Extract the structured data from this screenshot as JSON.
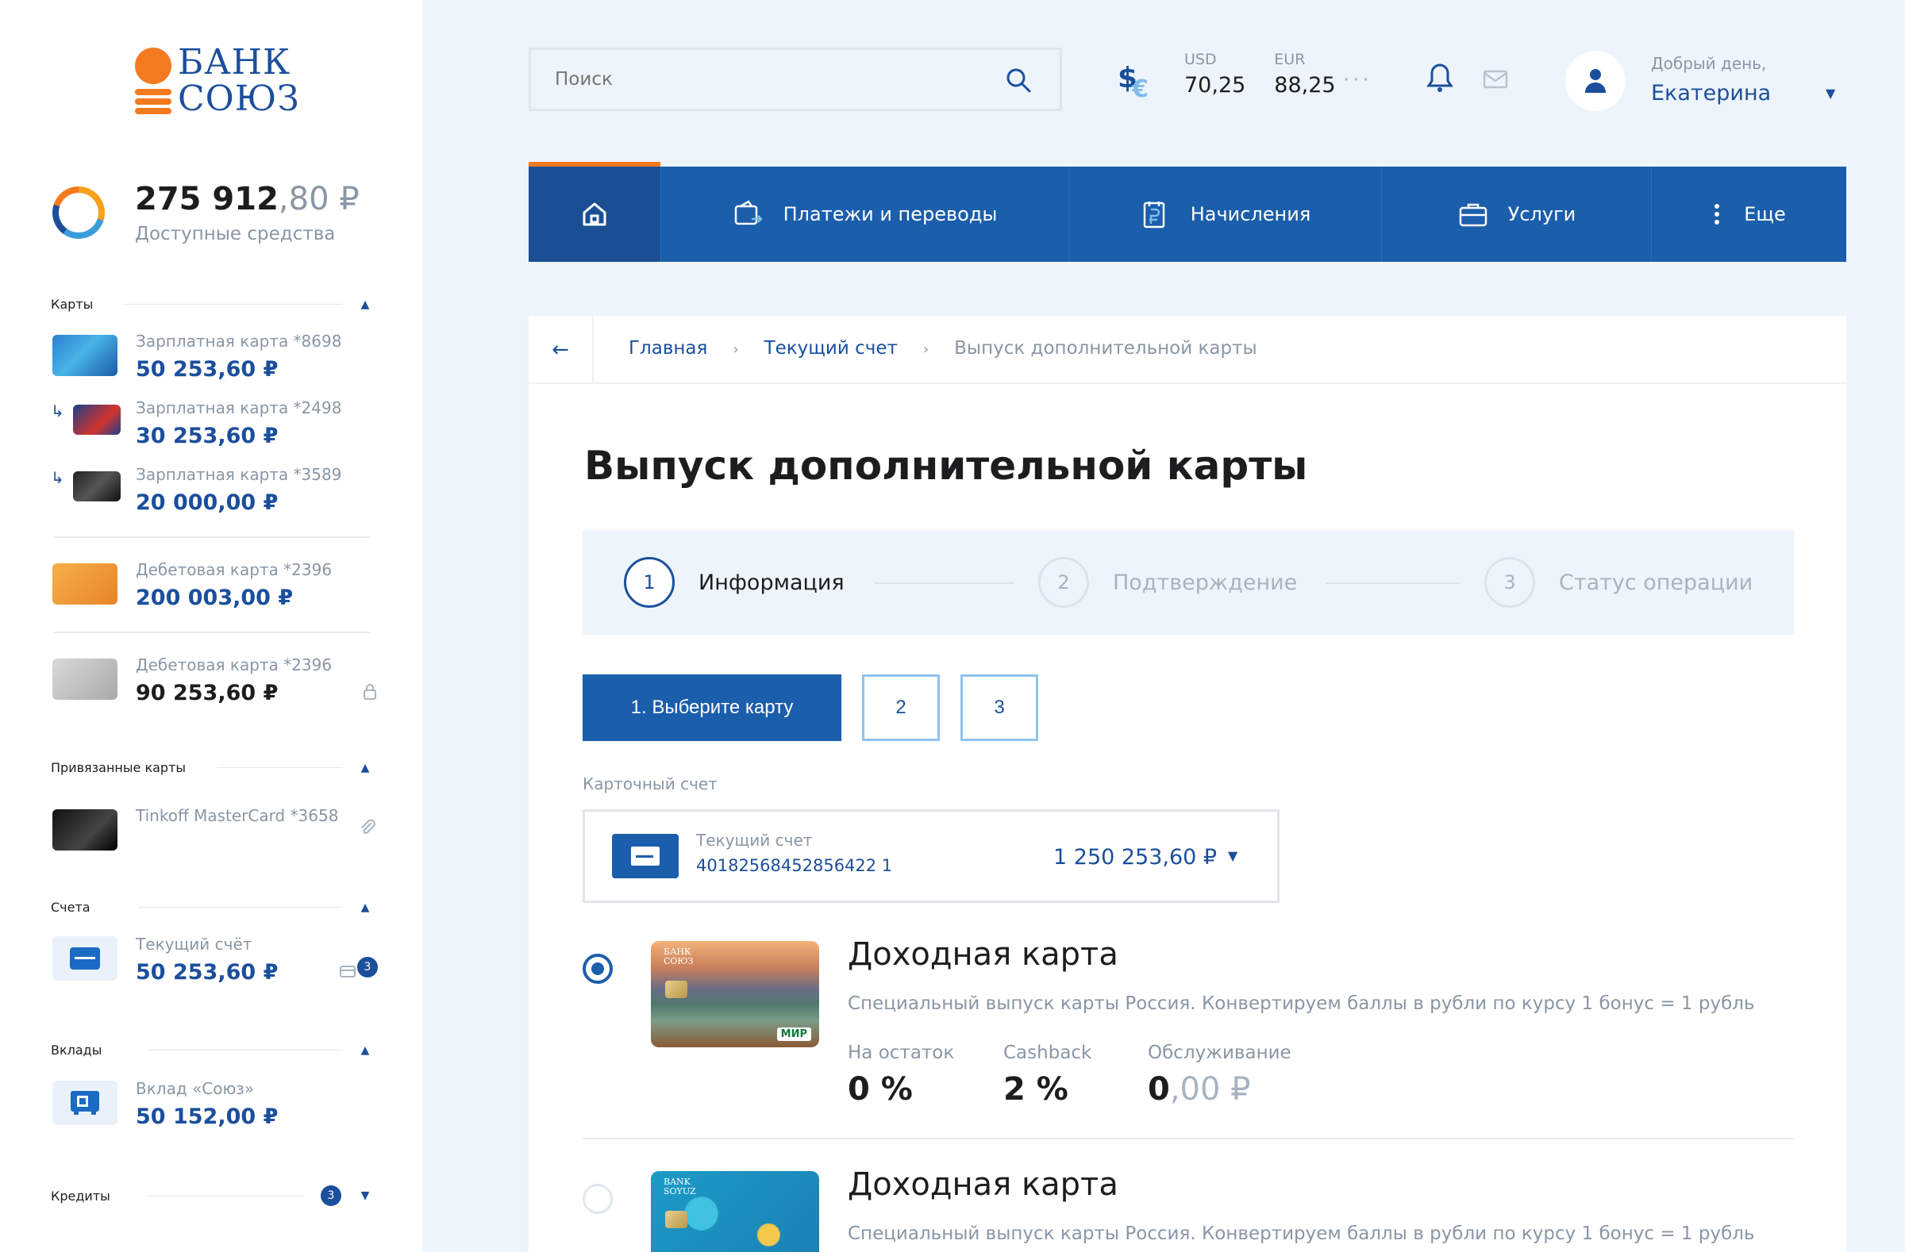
{
  "brand": {
    "line1": "БАНК",
    "line2": "СОЮЗ"
  },
  "balance": {
    "main": "275 912",
    "cents": ",80 ₽",
    "label": "Доступные средства"
  },
  "sidebar": {
    "cards_title": "Карты",
    "cards": [
      {
        "name": "Зарплатная карта *8698",
        "amount": "50 253,60 ₽"
      },
      {
        "name": "Зарплатная карта *2498",
        "amount": "30 253,60 ₽"
      },
      {
        "name": "Зарплатная карта *3589",
        "amount": "20 000,00 ₽"
      },
      {
        "name": "Дебетовая карта *2396",
        "amount": "200 003,00 ₽"
      },
      {
        "name": "Дебетовая карта *2396",
        "amount": "90 253,60 ₽"
      }
    ],
    "linked_title": "Привязанные карты",
    "linked": [
      {
        "name": "Tinkoff MasterCard *3658"
      }
    ],
    "accounts_title": "Счета",
    "accounts": [
      {
        "name": "Текущий счёт",
        "amount": "50 253,60 ₽",
        "badge": "3"
      }
    ],
    "deposits_title": "Вклады",
    "deposits": [
      {
        "name": "Вклад «Союз»",
        "amount": "50 152,00 ₽"
      }
    ],
    "credits_title": "Кредиты",
    "credits_count": "3"
  },
  "header": {
    "search_placeholder": "Поиск",
    "usd_label": "USD",
    "usd_value": "70,25",
    "eur_label": "EUR",
    "eur_value": "88,25",
    "more": "···",
    "greeting": "Добрый день,",
    "user_name": "Екатерина"
  },
  "nav": {
    "items": [
      {
        "label": "Платежи и переводы"
      },
      {
        "label": "Начисления"
      },
      {
        "label": "Услуги"
      },
      {
        "label": "Еще"
      }
    ]
  },
  "breadcrumbs": [
    "Главная",
    "Текущий счет",
    "Выпуск дополнительной карты"
  ],
  "page_title": "Выпуск дополнительной карты",
  "steps": [
    {
      "num": "1",
      "label": "Информация"
    },
    {
      "num": "2",
      "label": "Подтверждение"
    },
    {
      "num": "3",
      "label": "Статус операции"
    }
  ],
  "sub_tabs": {
    "primary": "1. Выберите карту",
    "second": "2",
    "third": "3"
  },
  "account_field": {
    "label": "Карточный счет",
    "name": "Текущий счет",
    "number": "40182568452856422 1",
    "amount": "1 250 253,60 ₽"
  },
  "products": [
    {
      "title": "Доходная карта",
      "desc": "Специальный выпуск карты Россия. Конвертируем баллы в рубли по курсу 1 бонус = 1 рубль",
      "card_brand": "БАНК\nСОЮЗ",
      "payment_system": "МИР",
      "selected": true,
      "stats": [
        {
          "label": "На остаток",
          "value": "0 %"
        },
        {
          "label": "Cashback",
          "value": "2 %"
        },
        {
          "label": "Обслуживание",
          "value": "0",
          "value_dim": ",00 ₽"
        }
      ]
    },
    {
      "title": "Доходная карта",
      "desc": "Специальный выпуск карты Россия. Конвертируем баллы в рубли по курсу 1 бонус = 1 рубль",
      "card_brand": "BANK\nSOYUZ",
      "selected": false
    }
  ],
  "colors": {
    "primary": "#1b5eab",
    "accent": "#f47a20",
    "bg": "#eef4fb"
  }
}
